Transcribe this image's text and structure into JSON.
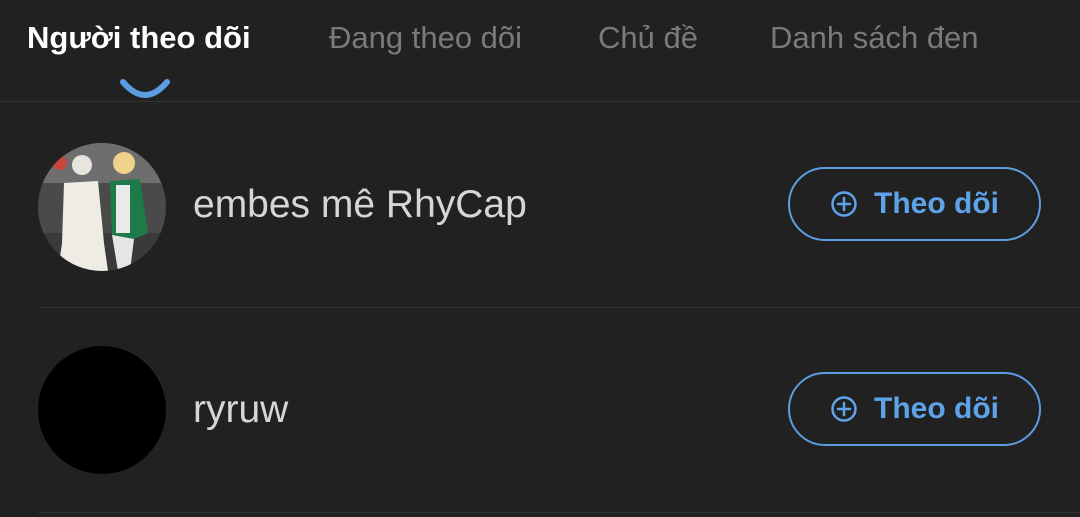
{
  "tabs": [
    {
      "label": "Người theo dõi",
      "active": true
    },
    {
      "label": "Đang theo dõi",
      "active": false
    },
    {
      "label": "Chủ đề",
      "active": false
    },
    {
      "label": "Danh sách đen",
      "active": false
    }
  ],
  "followers": [
    {
      "name": "embes mê RhyCap",
      "avatar": "photo-avatar",
      "button_label": "Theo dõi",
      "button_icon": "plus-circle-icon"
    },
    {
      "name": "ryruw",
      "avatar": "blank-black-avatar",
      "button_label": "Theo dõi",
      "button_icon": "plus-circle-icon"
    }
  ],
  "colors": {
    "background": "#212121",
    "accent": "#5ea3e8",
    "active_tab_text": "#ffffff",
    "inactive_tab_text": "#7a7a7a"
  }
}
